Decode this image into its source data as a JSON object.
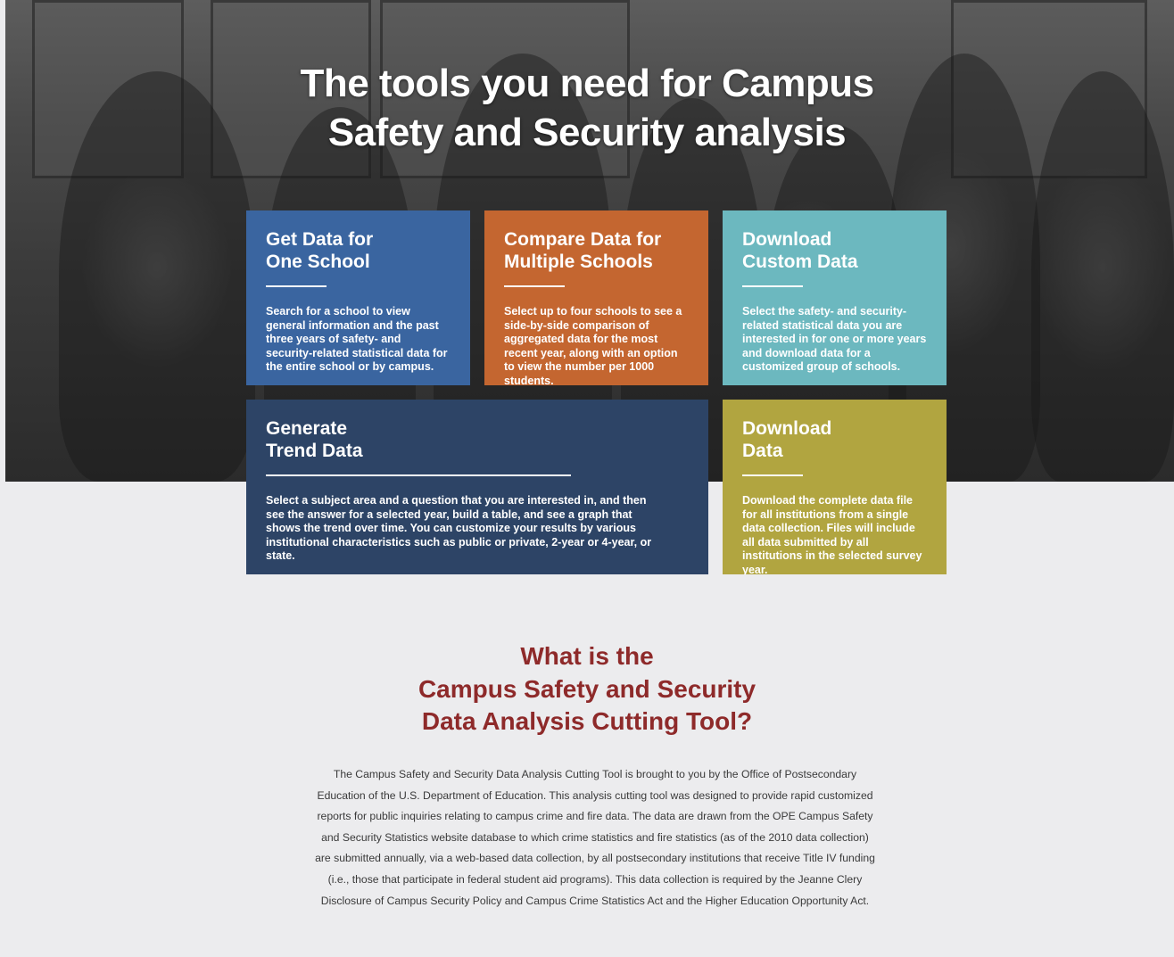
{
  "hero": {
    "title_line1": "The tools you need for Campus",
    "title_line2": "Safety and Security analysis"
  },
  "cards": {
    "one_school": {
      "title": "Get Data for\nOne School",
      "text": "Search for a school to view general information and the past three years of safety- and security-related statistical data for the entire school or by campus."
    },
    "compare": {
      "title": "Compare Data for\nMultiple Schools",
      "text": "Select up to four schools to see a side-by-side comparison of aggregated data for the most recent year, along with an option to view the number per 1000 students."
    },
    "custom": {
      "title": "Download\nCustom Data",
      "text": "Select the safety- and security-related statistical data you are interested in for one or more years and download data for a customized group of schools."
    },
    "trend": {
      "title": "Generate\nTrend Data",
      "text": "Select a subject area and a question that you are interested in, and then see the answer for a selected year, build a table, and see a graph that shows the trend over time. You can customize your results by various institutional characteristics such as public or private, 2-year or 4-year, or state."
    },
    "download": {
      "title": "Download\nData",
      "text": "Download the complete data file for all institutions from a single data collection. Files will include all data submitted by all institutions in the selected survey year."
    }
  },
  "about": {
    "heading_line1": "What is the",
    "heading_line2": "Campus Safety and Security",
    "heading_line3": "Data Analysis Cutting Tool?",
    "body": "The Campus Safety and Security Data Analysis Cutting Tool is brought to you by the Office of Postsecondary Education of the U.S. Department of Education. This analysis cutting tool was designed to provide rapid customized reports for public inquiries relating to campus crime and fire data. The data are drawn from the OPE Campus Safety and Security Statistics website database to which crime statistics and fire statistics (as of the 2010 data collection) are submitted annually, via a web-based data collection, by all postsecondary institutions that receive Title IV funding (i.e., those that participate in federal student aid programs). This data collection is required by the Jeanne Clery Disclosure of Campus Security Policy and Campus Crime Statistics Act and the Higher Education Opportunity Act."
  }
}
